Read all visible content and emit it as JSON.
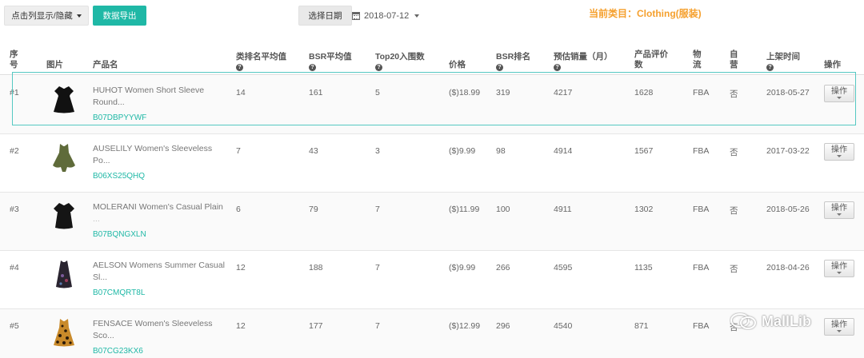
{
  "toolbar": {
    "toggle_columns_label": "点击列显示/隐藏",
    "export_label": "数据导出",
    "select_date_label": "选择日期",
    "date_value": "2018-07-12",
    "category_text": "当前类目：Clothing(服装)"
  },
  "table": {
    "headers": {
      "index_line1": "序",
      "index_line2": "号",
      "image": "图片",
      "product_name": "产品名",
      "rank_avg": "类排名平均值",
      "bsr_avg": "BSR平均值",
      "top20": "Top20入围数",
      "price": "价格",
      "bsr_rank": "BSR排名",
      "est_sales": "预估销量（月）",
      "reviews_line1": "产品评价",
      "reviews_line2": "数",
      "logistics_line1": "物",
      "logistics_line2": "流",
      "self_line1": "自",
      "self_line2": "营",
      "listed_time": "上架时间",
      "actions": "操作"
    },
    "rows": [
      {
        "index": "#1",
        "name_line1": "HUHOT Women Short Sleeve",
        "name_line2": "Round...",
        "asin": "B07DBPYYWF",
        "rank_avg": "14",
        "bsr_avg": "161",
        "top20": "5",
        "price": "($)18.99",
        "bsr": "319",
        "sales": "4217",
        "reviews": "1628",
        "logistics": "FBA",
        "self": "否",
        "date": "2018-05-27",
        "action": "操作"
      },
      {
        "index": "#2",
        "name_line1": "AUSELILY Women's Sleeveless",
        "name_line2": "Po...",
        "asin": "B06XS25QHQ",
        "rank_avg": "7",
        "bsr_avg": "43",
        "top20": "3",
        "price": "($)9.99",
        "bsr": "98",
        "sales": "4914",
        "reviews": "1567",
        "logistics": "FBA",
        "self": "否",
        "date": "2017-03-22",
        "action": "操作"
      },
      {
        "index": "#3",
        "name_line1": "MOLERANI Women's Casual Plain",
        "name_line2": "...",
        "asin": "B07BQNGXLN",
        "rank_avg": "6",
        "bsr_avg": "79",
        "top20": "7",
        "price": "($)11.99",
        "bsr": "100",
        "sales": "4911",
        "reviews": "1302",
        "logistics": "FBA",
        "self": "否",
        "date": "2018-05-26",
        "action": "操作"
      },
      {
        "index": "#4",
        "name_line1": "AELSON Womens Summer Casual",
        "name_line2": "Sl...",
        "asin": "B07CMQRT8L",
        "rank_avg": "12",
        "bsr_avg": "188",
        "top20": "7",
        "price": "($)9.99",
        "bsr": "266",
        "sales": "4595",
        "reviews": "1135",
        "logistics": "FBA",
        "self": "否",
        "date": "2018-04-26",
        "action": "操作"
      },
      {
        "index": "#5",
        "name_line1": "FENSACE Women's Sleeveless",
        "name_line2": "Sco...",
        "asin": "B07CG23KX6",
        "rank_avg": "12",
        "bsr_avg": "177",
        "top20": "7",
        "price": "($)12.99",
        "bsr": "296",
        "sales": "4540",
        "reviews": "871",
        "logistics": "FBA",
        "self": "否",
        "date": "",
        "action": "操作"
      }
    ]
  },
  "watermark": {
    "text": "MallLib"
  },
  "colors": {
    "accent": "#1fb8a6",
    "category": "#f5a02e"
  }
}
